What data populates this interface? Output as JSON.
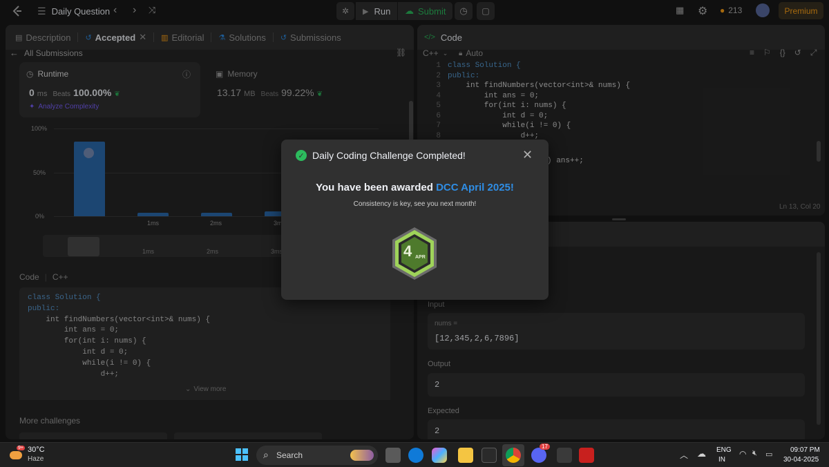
{
  "topbar": {
    "problem_list_label": "Daily Question",
    "run_label": "Run",
    "submit_label": "Submit",
    "streak_count": "213",
    "premium_label": "Premium"
  },
  "left_panel": {
    "tabs": [
      {
        "label": "Description"
      },
      {
        "label": "Accepted"
      },
      {
        "label": "Editorial"
      },
      {
        "label": "Solutions"
      },
      {
        "label": "Submissions"
      }
    ],
    "all_submissions_label": "All Submissions",
    "runtime": {
      "title": "Runtime",
      "value": "0",
      "unit": "ms",
      "beats_label": "Beats",
      "beats_value": "100.00%",
      "analyze_label": "Analyze Complexity"
    },
    "memory": {
      "title": "Memory",
      "value": "13.17",
      "unit": "MB",
      "beats_label": "Beats",
      "beats_value": "99.22%"
    },
    "chart": {
      "y_labels": [
        "100%",
        "50%",
        "0%"
      ],
      "x_labels": [
        "1ms",
        "2ms",
        "3ms"
      ],
      "mini_labels": [
        "1ms",
        "2ms",
        "3ms"
      ]
    },
    "code_section": {
      "header": "Code",
      "lang": "C++",
      "lines": [
        "class Solution {",
        "public:",
        "    int findNumbers(vector<int>& nums) {",
        "        int ans = 0;",
        "        for(int i: nums) {",
        "            int d = 0;",
        "            while(i != 0) {",
        "                d++;"
      ],
      "view_more": "View more"
    },
    "more_challenges": "More challenges"
  },
  "right_panel": {
    "title": "Code",
    "lang": "C++",
    "auto_label": "Auto",
    "line_numbers": [
      "1",
      "2",
      "3",
      "4",
      "5",
      "6",
      "7",
      "8"
    ],
    "lines": [
      "class Solution {",
      "public:",
      "    int findNumbers(vector<int>& nums) {",
      "        int ans = 0;",
      "        for(int i: nums) {",
      "            int d = 0;",
      "            while(i != 0) {",
      "                d++;"
    ],
    "partial_line": ") ans++;",
    "cursor_pos": "Ln 13, Col 20"
  },
  "testcase": {
    "input_label": "Input",
    "param_name": "nums =",
    "param_value": "[12,345,2,6,7896]",
    "output_label": "Output",
    "output_value": "2",
    "expected_label": "Expected",
    "expected_value": "2"
  },
  "modal": {
    "title": "Daily Coding Challenge Completed!",
    "awarded_prefix": "You have been awarded ",
    "award_name": "DCC April 2025!",
    "subtitle": "Consistency is key, see you next month!",
    "badge_number": "4",
    "badge_month": "APR"
  },
  "taskbar": {
    "temperature": "30°C",
    "weather": "Haze",
    "weather_badge": "9+",
    "search_label": "Search",
    "discord_badge": "17",
    "lang_top": "ENG",
    "lang_bottom": "IN",
    "time": "09:07 PM",
    "date": "30-04-2025"
  },
  "colors": {
    "accent_blue": "#2f8de4",
    "accepted_green": "#2cbb5d",
    "premium_orange": "#ffa116",
    "panel_bg": "#262626"
  }
}
